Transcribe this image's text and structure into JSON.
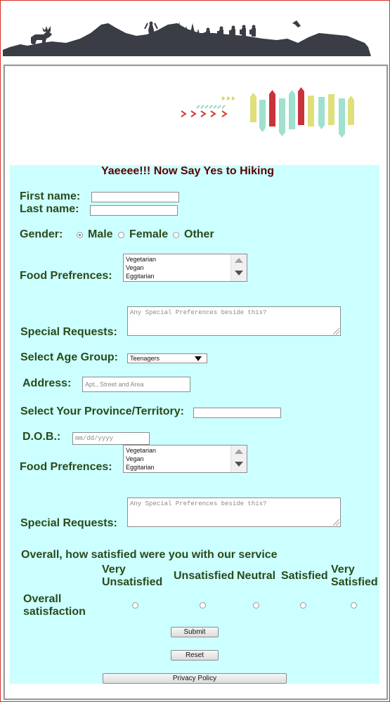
{
  "form": {
    "title": "Yaeeee!!! Now Say Yes to Hiking",
    "first_name_label": "First name:",
    "last_name_label": "Last name:",
    "first_name_value": "",
    "last_name_value": "",
    "gender_label": "Gender:",
    "gender_options": [
      "Male",
      "Female",
      "Other"
    ],
    "gender_selected": "Male",
    "food_pref_label": "Food Prefrences:",
    "food_options": [
      "Vegetarian",
      "Vegan",
      "Eggitarian"
    ],
    "special_requests_label": "Special Requests:",
    "special_requests_placeholder": "Any Special Preferences beside this?",
    "age_group_label": "Select Age Group:",
    "age_group_value": "Teenagers",
    "address_label": "Address:",
    "address_placeholder": "Apt., Street and Area",
    "province_label": "Select Your Province/Territory:",
    "province_value": "",
    "dob_label": "D.O.B.:",
    "dob_placeholder": "mm/dd/yyyy",
    "food_pref_label_2": "Food Prefrences:",
    "special_requests_label_2": "Special Requests:",
    "satisfaction_question": "Overall, how satisfied were you with our service",
    "satisfaction_scale": [
      "Very Unsatisfied",
      "Unsatisfied",
      "Neutral",
      "Satisfied",
      "Very Satisfied"
    ],
    "satisfaction_row_label": "Overall satisfaction",
    "submit_label": "Submit",
    "reset_label": "Reset",
    "privacy_label": "Privacy Policy"
  },
  "colors": {
    "form_background": "#ccffff",
    "label_text": "#2a4a1a",
    "title_text": "#5a0000",
    "banner_silhouette": "#3a3d45"
  }
}
